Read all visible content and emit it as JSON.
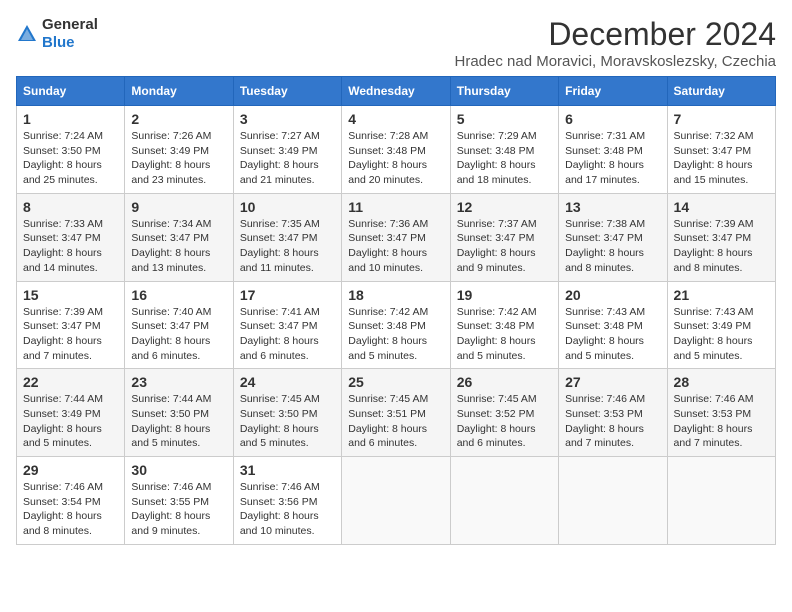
{
  "logo": {
    "general": "General",
    "blue": "Blue"
  },
  "title": "December 2024",
  "subtitle": "Hradec nad Moravici, Moravskoslezsky, Czechia",
  "headers": [
    "Sunday",
    "Monday",
    "Tuesday",
    "Wednesday",
    "Thursday",
    "Friday",
    "Saturday"
  ],
  "weeks": [
    [
      {
        "day": "1",
        "text": "Sunrise: 7:24 AM\nSunset: 3:50 PM\nDaylight: 8 hours\nand 25 minutes."
      },
      {
        "day": "2",
        "text": "Sunrise: 7:26 AM\nSunset: 3:49 PM\nDaylight: 8 hours\nand 23 minutes."
      },
      {
        "day": "3",
        "text": "Sunrise: 7:27 AM\nSunset: 3:49 PM\nDaylight: 8 hours\nand 21 minutes."
      },
      {
        "day": "4",
        "text": "Sunrise: 7:28 AM\nSunset: 3:48 PM\nDaylight: 8 hours\nand 20 minutes."
      },
      {
        "day": "5",
        "text": "Sunrise: 7:29 AM\nSunset: 3:48 PM\nDaylight: 8 hours\nand 18 minutes."
      },
      {
        "day": "6",
        "text": "Sunrise: 7:31 AM\nSunset: 3:48 PM\nDaylight: 8 hours\nand 17 minutes."
      },
      {
        "day": "7",
        "text": "Sunrise: 7:32 AM\nSunset: 3:47 PM\nDaylight: 8 hours\nand 15 minutes."
      }
    ],
    [
      {
        "day": "8",
        "text": "Sunrise: 7:33 AM\nSunset: 3:47 PM\nDaylight: 8 hours\nand 14 minutes."
      },
      {
        "day": "9",
        "text": "Sunrise: 7:34 AM\nSunset: 3:47 PM\nDaylight: 8 hours\nand 13 minutes."
      },
      {
        "day": "10",
        "text": "Sunrise: 7:35 AM\nSunset: 3:47 PM\nDaylight: 8 hours\nand 11 minutes."
      },
      {
        "day": "11",
        "text": "Sunrise: 7:36 AM\nSunset: 3:47 PM\nDaylight: 8 hours\nand 10 minutes."
      },
      {
        "day": "12",
        "text": "Sunrise: 7:37 AM\nSunset: 3:47 PM\nDaylight: 8 hours\nand 9 minutes."
      },
      {
        "day": "13",
        "text": "Sunrise: 7:38 AM\nSunset: 3:47 PM\nDaylight: 8 hours\nand 8 minutes."
      },
      {
        "day": "14",
        "text": "Sunrise: 7:39 AM\nSunset: 3:47 PM\nDaylight: 8 hours\nand 8 minutes."
      }
    ],
    [
      {
        "day": "15",
        "text": "Sunrise: 7:39 AM\nSunset: 3:47 PM\nDaylight: 8 hours\nand 7 minutes."
      },
      {
        "day": "16",
        "text": "Sunrise: 7:40 AM\nSunset: 3:47 PM\nDaylight: 8 hours\nand 6 minutes."
      },
      {
        "day": "17",
        "text": "Sunrise: 7:41 AM\nSunset: 3:47 PM\nDaylight: 8 hours\nand 6 minutes."
      },
      {
        "day": "18",
        "text": "Sunrise: 7:42 AM\nSunset: 3:48 PM\nDaylight: 8 hours\nand 5 minutes."
      },
      {
        "day": "19",
        "text": "Sunrise: 7:42 AM\nSunset: 3:48 PM\nDaylight: 8 hours\nand 5 minutes."
      },
      {
        "day": "20",
        "text": "Sunrise: 7:43 AM\nSunset: 3:48 PM\nDaylight: 8 hours\nand 5 minutes."
      },
      {
        "day": "21",
        "text": "Sunrise: 7:43 AM\nSunset: 3:49 PM\nDaylight: 8 hours\nand 5 minutes."
      }
    ],
    [
      {
        "day": "22",
        "text": "Sunrise: 7:44 AM\nSunset: 3:49 PM\nDaylight: 8 hours\nand 5 minutes."
      },
      {
        "day": "23",
        "text": "Sunrise: 7:44 AM\nSunset: 3:50 PM\nDaylight: 8 hours\nand 5 minutes."
      },
      {
        "day": "24",
        "text": "Sunrise: 7:45 AM\nSunset: 3:50 PM\nDaylight: 8 hours\nand 5 minutes."
      },
      {
        "day": "25",
        "text": "Sunrise: 7:45 AM\nSunset: 3:51 PM\nDaylight: 8 hours\nand 6 minutes."
      },
      {
        "day": "26",
        "text": "Sunrise: 7:45 AM\nSunset: 3:52 PM\nDaylight: 8 hours\nand 6 minutes."
      },
      {
        "day": "27",
        "text": "Sunrise: 7:46 AM\nSunset: 3:53 PM\nDaylight: 8 hours\nand 7 minutes."
      },
      {
        "day": "28",
        "text": "Sunrise: 7:46 AM\nSunset: 3:53 PM\nDaylight: 8 hours\nand 7 minutes."
      }
    ],
    [
      {
        "day": "29",
        "text": "Sunrise: 7:46 AM\nSunset: 3:54 PM\nDaylight: 8 hours\nand 8 minutes."
      },
      {
        "day": "30",
        "text": "Sunrise: 7:46 AM\nSunset: 3:55 PM\nDaylight: 8 hours\nand 9 minutes."
      },
      {
        "day": "31",
        "text": "Sunrise: 7:46 AM\nSunset: 3:56 PM\nDaylight: 8 hours\nand 10 minutes."
      },
      null,
      null,
      null,
      null
    ]
  ]
}
